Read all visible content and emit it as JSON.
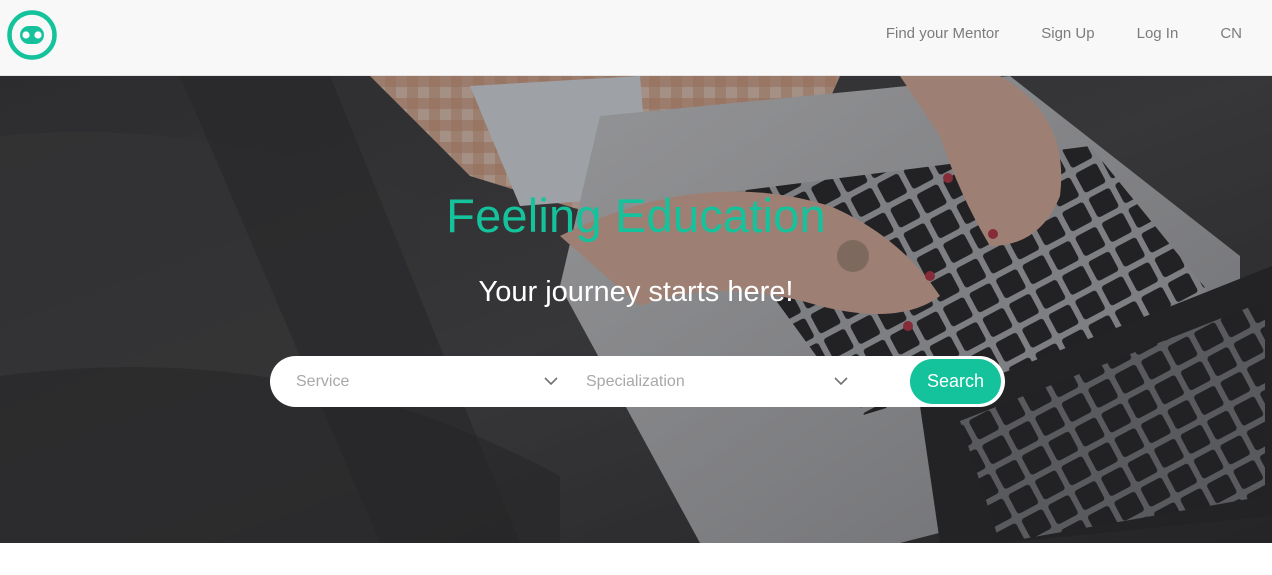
{
  "header": {
    "logo": {
      "icon": "smiley-logo-icon",
      "color": "#14c39c"
    },
    "nav": {
      "find_mentor": "Find your Mentor",
      "sign_up": "Sign Up",
      "log_in": "Log In",
      "language": "CN"
    }
  },
  "hero": {
    "title": "Feeling Education",
    "subtitle": "Your journey starts here!",
    "search": {
      "service_placeholder": "Service",
      "specialization_placeholder": "Specialization",
      "button_label": "Search"
    }
  },
  "colors": {
    "accent": "#14c39c",
    "nav_text": "#7b7b7b",
    "placeholder_text": "#a8a8a8",
    "header_bg": "#f8f8f8"
  }
}
